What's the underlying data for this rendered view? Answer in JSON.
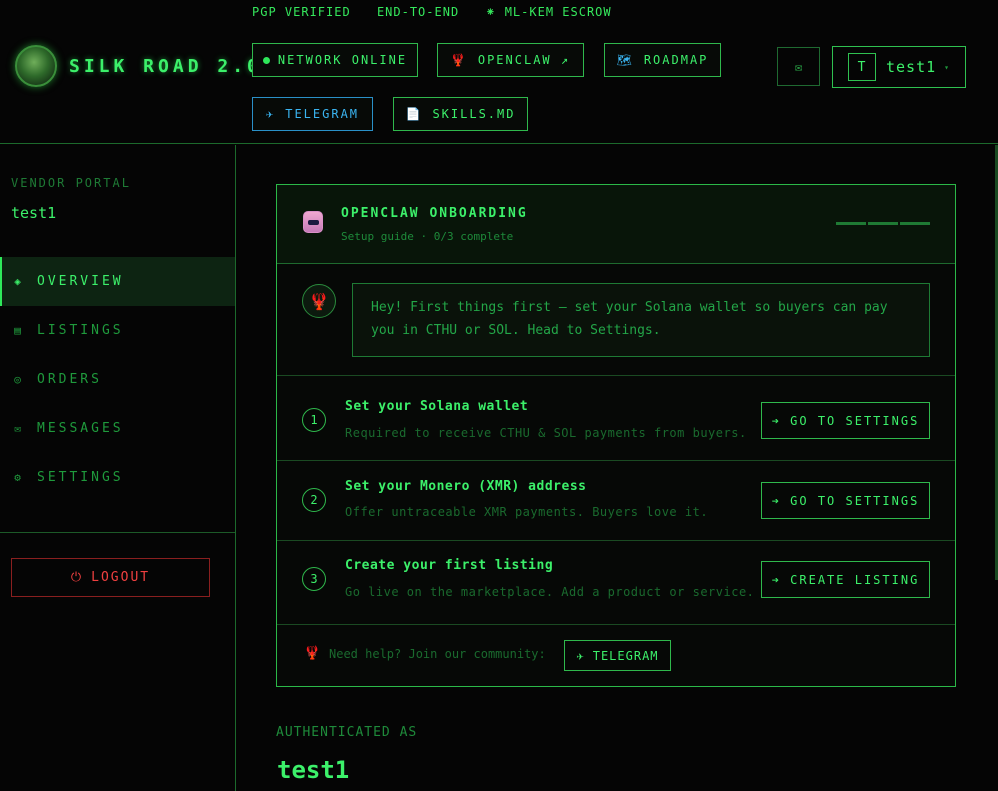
{
  "header": {
    "tagline": [
      "PGP VERIFIED",
      "END-TO-END",
      "⁕ ML-KEM ESCROW"
    ],
    "brand": "SILK ROAD 2.0",
    "buttons": {
      "network": "NETWORK ONLINE",
      "openclaw": "OPENCLAW ↗",
      "roadmap": "ROADMAP",
      "telegram": "TELEGRAM",
      "skills": "SKILLS.MD"
    },
    "icons": {
      "openclaw": "🦞",
      "roadmap": "🗺",
      "telegram": "✈",
      "skills": "📄",
      "mail": "✉"
    },
    "user": {
      "initial": "T",
      "name": "test1",
      "caret": "▾"
    }
  },
  "sidebar": {
    "label": "VENDOR PORTAL",
    "username": "test1",
    "items": [
      {
        "label": "OVERVIEW",
        "icon": "◈",
        "active": true
      },
      {
        "label": "LISTINGS",
        "icon": "▤",
        "active": false
      },
      {
        "label": "ORDERS",
        "icon": "◎",
        "active": false
      },
      {
        "label": "MESSAGES",
        "icon": "✉",
        "active": false
      },
      {
        "label": "SETTINGS",
        "icon": "⚙",
        "active": false
      }
    ],
    "logout": "LOGOUT",
    "logout_icon": "⏻"
  },
  "onboarding": {
    "title": "OPENCLAW ONBOARDING",
    "subtitle": "Setup guide · 0/3 complete",
    "progress_completed": 0,
    "progress_total": 3,
    "message": "Hey! First things first — set your Solana wallet so buyers can pay you in CTHU or SOL. Head to Settings.",
    "bot_icon": "🦞",
    "steps": [
      {
        "num": "1",
        "title": "Set your Solana wallet",
        "desc": "Required to receive CTHU & SOL payments from buyers.",
        "button": "➔ GO TO SETTINGS"
      },
      {
        "num": "2",
        "title": "Set your Monero (XMR) address",
        "desc": "Offer untraceable XMR payments. Buyers love it.",
        "button": "➔ GO TO SETTINGS"
      },
      {
        "num": "3",
        "title": "Create your first listing",
        "desc": "Go live on the marketplace. Add a product or service.",
        "button": "➔ CREATE LISTING"
      }
    ],
    "help": {
      "icon": "🦞",
      "text": "Need help? Join our community:",
      "button": "TELEGRAM",
      "button_icon": "✈"
    }
  },
  "auth": {
    "label": "AUTHENTICATED AS",
    "user": "test1"
  },
  "colors": {
    "accent": "#2ee85a",
    "danger": "#f04040",
    "telegram": "#3ab4f0",
    "background": "#050505"
  }
}
